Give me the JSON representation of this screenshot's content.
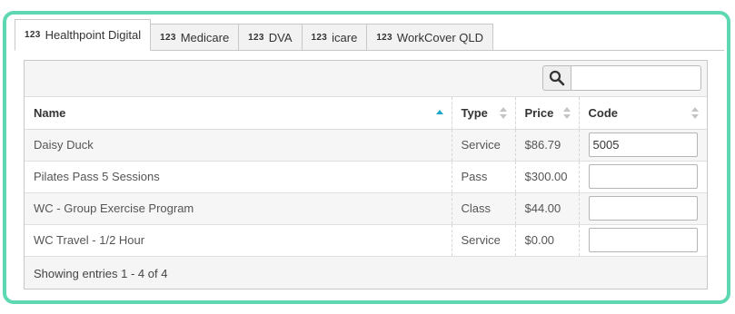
{
  "tabs": [
    {
      "num": "123",
      "label": "Healthpoint Digital",
      "active": true
    },
    {
      "num": "123",
      "label": "Medicare",
      "active": false
    },
    {
      "num": "123",
      "label": "DVA",
      "active": false
    },
    {
      "num": "123",
      "label": "icare",
      "active": false
    },
    {
      "num": "123",
      "label": "WorkCover QLD",
      "active": false
    }
  ],
  "search": {
    "icon": "magnifier-icon",
    "value": "",
    "placeholder": ""
  },
  "table": {
    "columns": [
      "Name",
      "Type",
      "Price",
      "Code"
    ],
    "sorted_column": "Name",
    "sort_direction": "ascending",
    "rows": [
      {
        "name": "Daisy Duck",
        "type": "Service",
        "price": "$86.79",
        "code": "5005"
      },
      {
        "name": "Pilates Pass 5 Sessions",
        "type": "Pass",
        "price": "$300.00",
        "code": ""
      },
      {
        "name": "WC - Group Exercise Program",
        "type": "Class",
        "price": "$44.00",
        "code": ""
      },
      {
        "name": "WC Travel - 1/2 Hour",
        "type": "Service",
        "price": "$0.00",
        "code": ""
      }
    ]
  },
  "footer": {
    "info": "Showing entries 1 - 4 of 4"
  },
  "colors": {
    "border_accent": "#5dd8b2",
    "sort_active": "#1ba7c9"
  }
}
